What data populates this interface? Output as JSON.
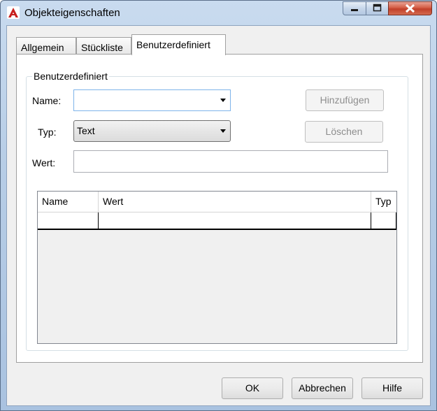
{
  "window": {
    "title": "Objekteigenschaften",
    "icon": "autocad-a-icon",
    "accent": "#c1402a"
  },
  "tabs": [
    {
      "label": "Allgemein",
      "active": false
    },
    {
      "label": "Stückliste",
      "active": false
    },
    {
      "label": "Benutzerdefiniert",
      "active": true
    }
  ],
  "group": {
    "title": "Benutzerdefiniert"
  },
  "form": {
    "name_label": "Name:",
    "name_value": "",
    "type_label": "Typ:",
    "type_value": "Text",
    "value_label": "Wert:",
    "value_value": ""
  },
  "buttons": {
    "add": "Hinzufügen",
    "delete": "Löschen",
    "ok": "OK",
    "cancel": "Abbrechen",
    "help": "Hilfe"
  },
  "table": {
    "columns": [
      "Name",
      "Wert",
      "Typ"
    ],
    "rows": [
      [
        "",
        "",
        ""
      ]
    ]
  }
}
